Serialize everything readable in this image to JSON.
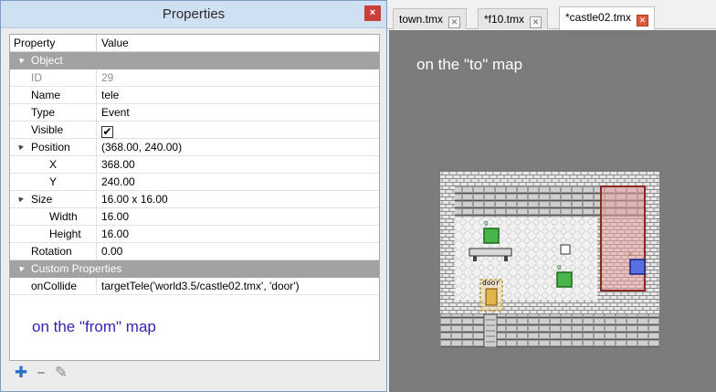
{
  "properties_panel": {
    "title": "Properties",
    "close_glyph": "×",
    "headers": {
      "property": "Property",
      "value": "Value"
    },
    "object_group": "Object",
    "rows": [
      {
        "name": "ID",
        "value": "29",
        "disabled": true
      },
      {
        "name": "Name",
        "value": "tele"
      },
      {
        "name": "Type",
        "value": "Event"
      },
      {
        "name": "Visible",
        "value": "✔",
        "checkbox": true
      },
      {
        "name": "Position",
        "value": "(368.00, 240.00)",
        "expandable": true
      },
      {
        "name": "X",
        "value": "368.00",
        "child": true
      },
      {
        "name": "Y",
        "value": "240.00",
        "child": true
      },
      {
        "name": "Size",
        "value": "16.00 x 16.00",
        "expandable": true
      },
      {
        "name": "Width",
        "value": "16.00",
        "child": true
      },
      {
        "name": "Height",
        "value": "16.00",
        "child": true
      },
      {
        "name": "Rotation",
        "value": "0.00"
      }
    ],
    "custom_group": "Custom Properties",
    "custom_rows": [
      {
        "name": "onCollide",
        "value": "targetTele('world3.5/castle02.tmx', 'door')"
      }
    ],
    "annotation": "on the \"from\" map",
    "toolbar": {
      "add_icon": "plus-icon",
      "add_glyph": "✚",
      "remove_icon": "minus-icon",
      "remove_glyph": "━",
      "rename_icon": "pencil-icon",
      "rename_glyph": "✎"
    }
  },
  "editor": {
    "tabs": [
      {
        "label": "town.tmx",
        "active": false
      },
      {
        "label": "*f10.tmx",
        "active": false
      },
      {
        "label": "*castle02.tmx",
        "active": true
      }
    ],
    "tab_close_glyph": "✕",
    "annotation": "on the \"to\" map",
    "map": {
      "sign_small_1": "g",
      "sign_small_2": "g",
      "sign_small_3": "s...",
      "door_label": "door"
    }
  },
  "colors": {
    "annotation_from": "#3a1fb5",
    "annotation_to": "#ffffff",
    "canvas_bg": "#7b7b7b",
    "group_row_bg": "#a2a2a2",
    "close_button": "#c9403a",
    "title_bar": "#cfe0f2",
    "teleport_zone": "#c0392b"
  }
}
